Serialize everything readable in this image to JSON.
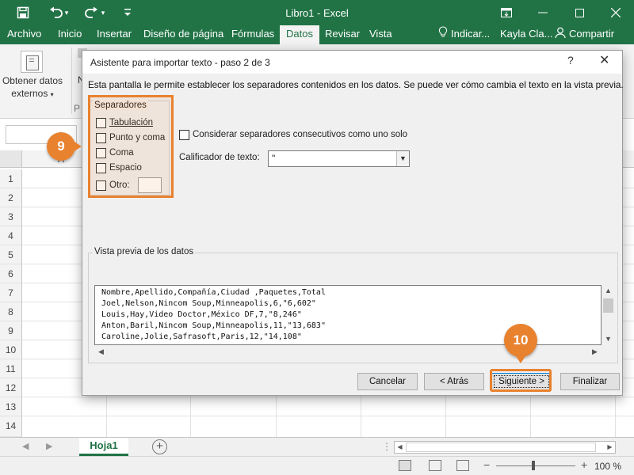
{
  "app": {
    "title": "Libro1 - Excel",
    "window_controls": {
      "ribbon_display": "⧉",
      "minimize": "—",
      "maximize": "☐",
      "close": "✕"
    }
  },
  "qat": {
    "save_icon": "save-icon",
    "undo_icon": "undo-icon",
    "redo_icon": "redo-icon",
    "customize_icon": "customize-qat-icon"
  },
  "ribbon_tabs": [
    "Archivo",
    "Inicio",
    "Insertar",
    "Diseño de página",
    "Fórmulas",
    "Datos",
    "Revisar",
    "Vista"
  ],
  "active_tab": "Datos",
  "tell_me": "Indicar...",
  "user": "Kayla Cla...",
  "share": "Compartir",
  "ribbon": {
    "get_data_line1": "Obtener datos",
    "get_data_line2": "externos",
    "clipped_n": "N",
    "clipped_p": "P"
  },
  "grid": {
    "col_a": "A",
    "rows": [
      "1",
      "2",
      "3",
      "4",
      "5",
      "6",
      "7",
      "8",
      "9",
      "10",
      "11",
      "12",
      "13",
      "14"
    ]
  },
  "sheet_tab": "Hoja1",
  "add_sheet": "+",
  "zoom": {
    "minus": "−",
    "plus": "+",
    "level": "100 %"
  },
  "dialog": {
    "title": "Asistente para importar texto - paso 2 de 3",
    "help": "?",
    "close": "✕",
    "description": "Esta pantalla le permite establecer los separadores contenidos en los datos. Se puede ver cómo cambia el texto en la vista previa.",
    "separators": {
      "title": "Separadores",
      "tab": "Tabulación",
      "semicolon": "Punto y coma",
      "comma": "Coma",
      "space": "Espacio",
      "other": "Otro:"
    },
    "consecutive": "Considerar separadores consecutivos como uno solo",
    "qualifier_label": "Calificador de texto:",
    "qualifier_value": "\"",
    "preview_title": "Vista previa de los datos",
    "preview_lines": [
      "Nombre,Apellido,Compañía,Ciudad ,Paquetes,Total",
      "Joel,Nelson,Nincom Soup,Minneapolis,6,\"6,602\"",
      "Louis,Hay,Video Doctor,México DF,7,\"8,246\"",
      "Anton,Baril,Nincom Soup,Minneapolis,11,\"13,683\"",
      "Caroline,Jolie,Safrasoft,Paris,12,\"14,108\""
    ],
    "buttons": {
      "cancel": "Cancelar",
      "back": "< Atrás",
      "next": "Siguiente >",
      "finish": "Finalizar"
    }
  },
  "callouts": {
    "step9": "9",
    "step10": "10"
  },
  "colors": {
    "excel_green": "#217346",
    "callout_orange": "#e8822f"
  }
}
